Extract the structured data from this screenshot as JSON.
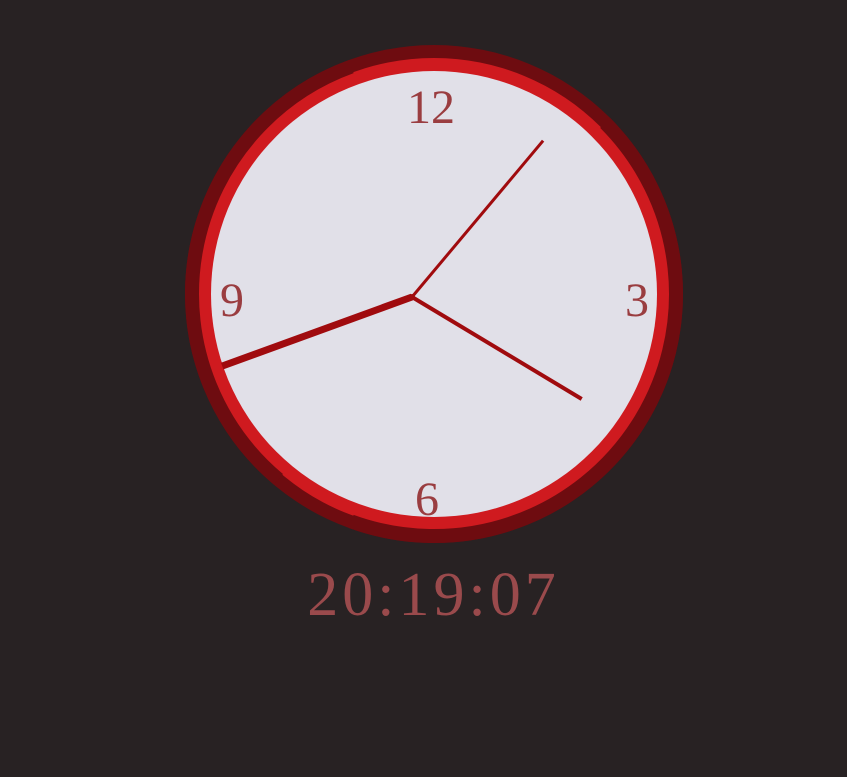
{
  "clock": {
    "numerals": {
      "twelve": "12",
      "three": "3",
      "six": "6",
      "nine": "9"
    },
    "time": {
      "hours": 20,
      "minutes": 19,
      "seconds": 7
    },
    "hand_angles_deg": {
      "hour": 250,
      "minute": 121,
      "second": 40
    },
    "digital_display": "20:19:07"
  },
  "colors": {
    "background": "#282223",
    "face": "#e1e0e8",
    "rim_outer": "#6e0c10",
    "rim_inner": "#cf1a1f",
    "hands": "#a00b0e",
    "numerals": "#9a3d40",
    "digital": "#9a4a4c"
  }
}
